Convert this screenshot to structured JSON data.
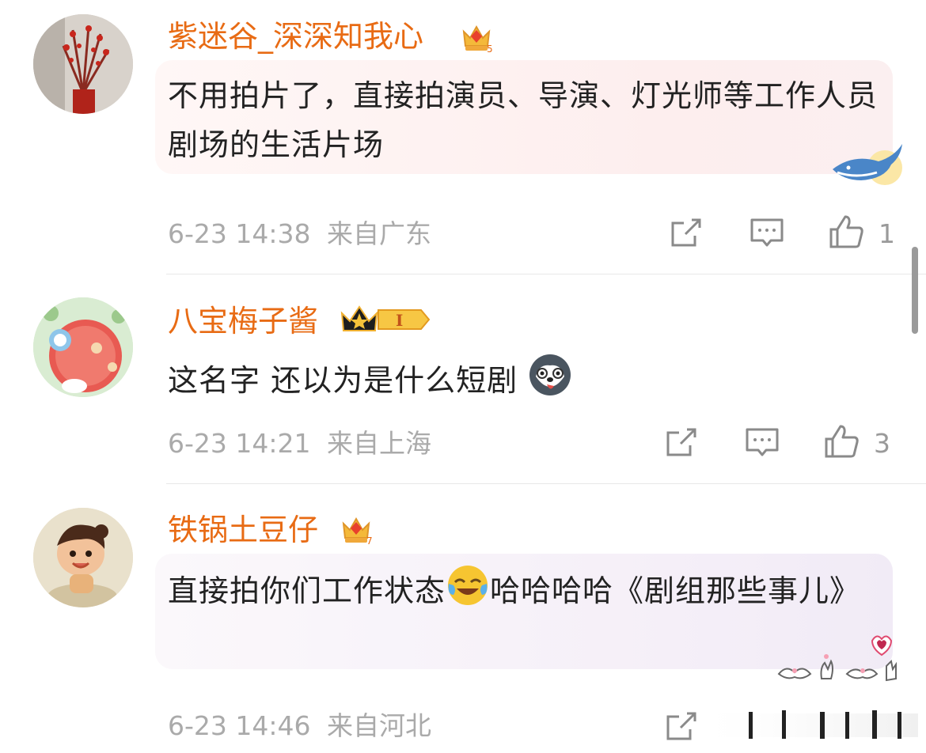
{
  "comments": [
    {
      "username": "紫迷谷_深深知我心",
      "badge_level": "5",
      "text": "不用拍片了，直接拍演员、导演、灯光师等工作人员剧场的生活片场",
      "date": "6-23 14:38",
      "location": "来自广东",
      "likes": "1"
    },
    {
      "username": "八宝梅子酱",
      "badge_level": "I",
      "text_before_emoji": "这名字 还以为是什么短剧",
      "date": "6-23 14:21",
      "location": "来自上海",
      "likes": "3"
    },
    {
      "username": "铁锅土豆仔",
      "badge_level": "7",
      "text_before_emoji": "直接拍你们工作状态",
      "text_after_emoji": "哈哈哈哈《剧组那些事儿》",
      "date": "6-23 14:46",
      "location": "来自河北"
    }
  ],
  "icons": {
    "repost": "share-icon",
    "comment": "comment-icon",
    "like": "thumbs-up-icon"
  },
  "colors": {
    "username": "#e86b14",
    "meta": "#aaaaaa",
    "bubble1": "#fdf0ef",
    "bubble3": "#f3eef8"
  }
}
